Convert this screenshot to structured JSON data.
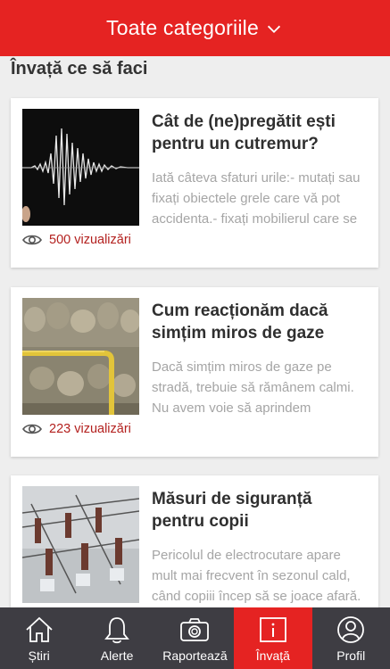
{
  "header": {
    "title": "Toate categoriile",
    "chevron_icon": "chevron-down-icon"
  },
  "section": {
    "title": "Învață ce să faci"
  },
  "articles": [
    {
      "title": "Cât de (ne)pregătit ești pentru un cutremur?",
      "excerpt": "Iată câteva sfaturi urile:- mutați sau fixați obiectele grele care vă pot accidenta.- fixați mobilierul care se poate...",
      "views": "500 vizualizări",
      "image": "seismograph"
    },
    {
      "title": "Cum reacționăm dacă simțim miros de gaze",
      "excerpt": "Dacă simțim miros de gaze pe stradă, trebuie să rămânem calmi. Nu avem voie să aprindem chibrituri, brichete...",
      "views": "223 vizualizări",
      "image": "gas-pipe-wall"
    },
    {
      "title": "Măsuri de siguranță pentru copii",
      "excerpt": "Pericolul de electrocutare apare mult mai frecvent în sezonul cald, când copiii încep să se joace afară. Verificați ca și ci...",
      "views": "",
      "image": "power-insulators"
    }
  ],
  "nav": {
    "items": [
      {
        "label": "Știri",
        "icon": "home-icon"
      },
      {
        "label": "Alerte",
        "icon": "bell-icon"
      },
      {
        "label": "Raportează",
        "icon": "camera-icon"
      },
      {
        "label": "Învață",
        "icon": "info-icon",
        "active": true
      },
      {
        "label": "Profil",
        "icon": "profile-icon"
      }
    ]
  },
  "colors": {
    "brand_red": "#e52322",
    "nav_bg": "#3e3d43",
    "views_red": "#b3201e"
  }
}
